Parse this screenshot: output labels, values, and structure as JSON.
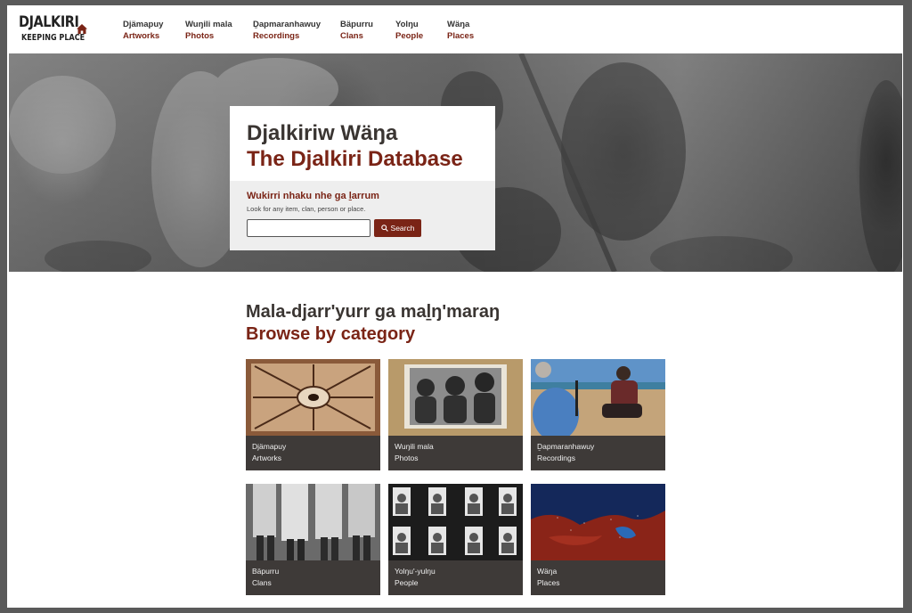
{
  "header": {
    "logo_main": "DJALKIRI",
    "logo_sub": "KEEPING PLACE",
    "nav": [
      {
        "yolngu": "Djämapuy",
        "english": "Artworks"
      },
      {
        "yolngu": "Wuŋili mala",
        "english": "Photos"
      },
      {
        "yolngu": "Ḏapmaranhawuy",
        "english": "Recordings"
      },
      {
        "yolngu": "Bäpurru",
        "english": "Clans"
      },
      {
        "yolngu": "Yolŋu",
        "english": "People"
      },
      {
        "yolngu": "Wäŋa",
        "english": "Places"
      }
    ]
  },
  "hero": {
    "title_yolngu": "Djalkiriw Wäŋa",
    "title_english": "The Djalkiri Database",
    "search_heading": "Wukirri nhaku nhe ga ḻarrum",
    "search_help": "Look for any item, clan, person or place.",
    "search_value": "",
    "search_button": "Search"
  },
  "browse": {
    "title_yolngu": "Mala-djarr'yurr ga maḻŋ'maraŋ",
    "title_english": "Browse by category",
    "tiles": [
      {
        "yolngu": "Djämapuy",
        "english": "Artworks"
      },
      {
        "yolngu": "Wuŋili mala",
        "english": "Photos"
      },
      {
        "yolngu": "Ḏapmaranhawuy",
        "english": "Recordings"
      },
      {
        "yolngu": "Bäpurru",
        "english": "Clans"
      },
      {
        "yolngu": "Yolŋu'-yulŋu",
        "english": "People"
      },
      {
        "yolngu": "Wäŋa",
        "english": "Places"
      }
    ]
  },
  "colors": {
    "accent": "#7a2416",
    "heading": "#3a3532",
    "tile_bg": "#3e3a38"
  }
}
